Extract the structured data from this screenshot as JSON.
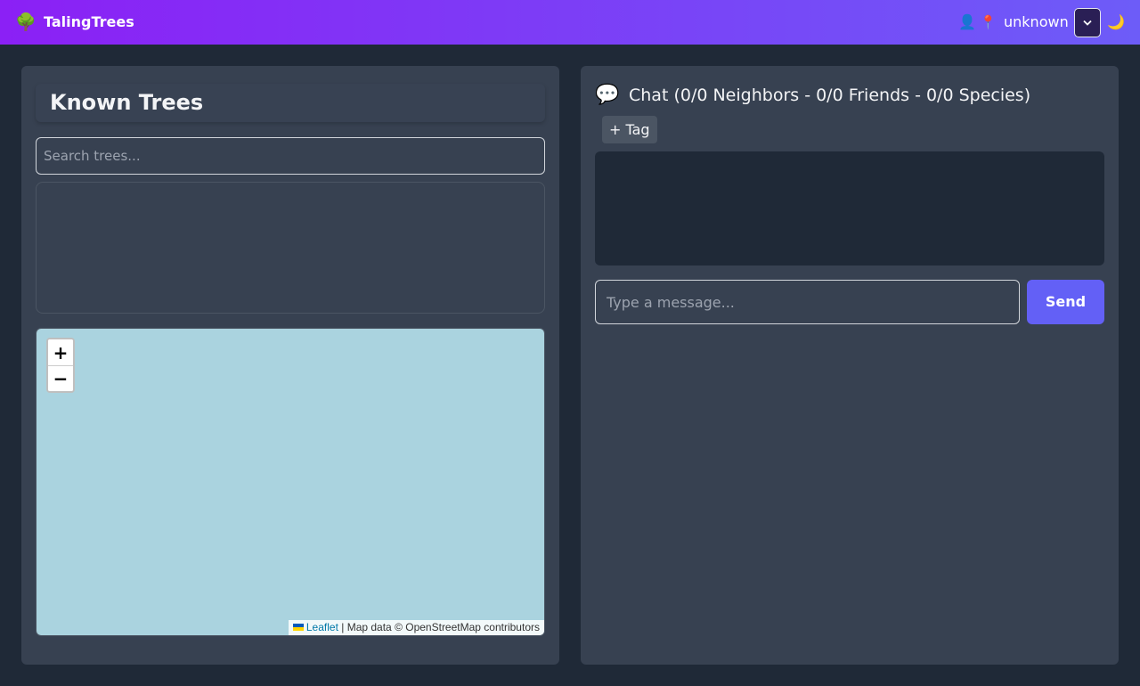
{
  "header": {
    "brand_icon": "🌳",
    "app_title": "TalingTrees",
    "user_icon": "👤",
    "pin_icon": "📍",
    "location": "unknown",
    "moon_icon": "🌙",
    "colors": {
      "gradient_start": "#8b20f5",
      "gradient_end": "#6d5cf8"
    }
  },
  "trees": {
    "heading": "Known Trees",
    "search_placeholder": "Search trees...",
    "items": []
  },
  "map": {
    "zoom_in": "+",
    "zoom_out": "−",
    "attribution_link": "Leaflet",
    "attribution_text": "| Map data © OpenStreetMap contributors"
  },
  "chat": {
    "icon": "💬",
    "title": "Chat (0/0 Neighbors - 0/0 Friends - 0/0 Species)",
    "tag_label": "+ Tag",
    "messages": [],
    "input_placeholder": "Type a message...",
    "send_label": "Send",
    "accent_color": "#6360f6"
  }
}
